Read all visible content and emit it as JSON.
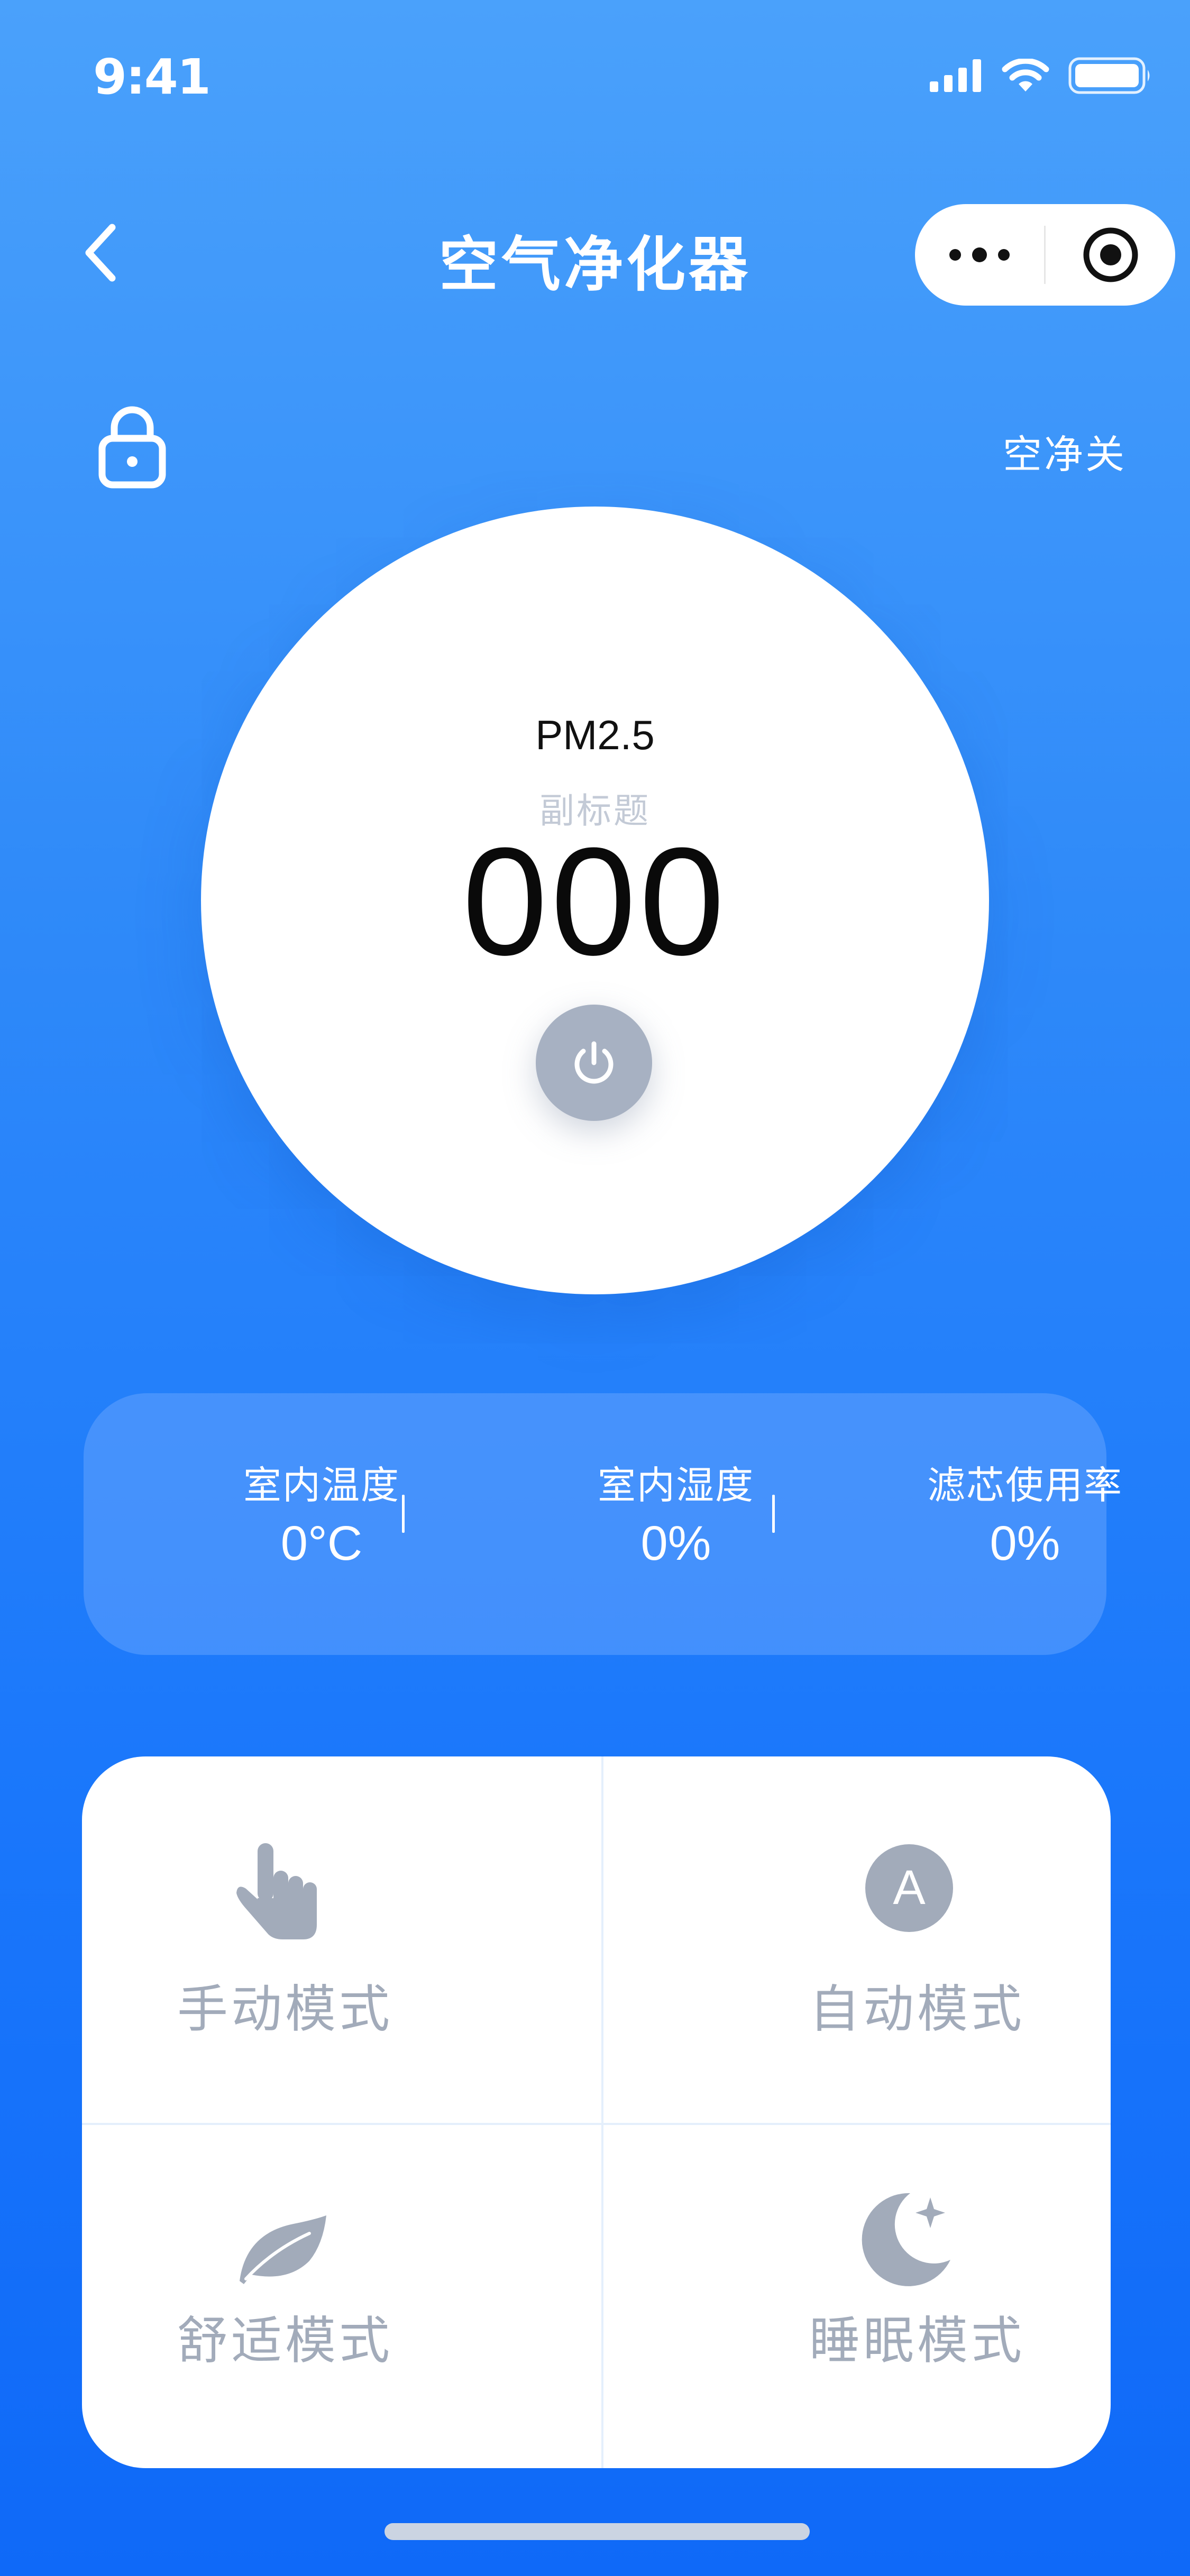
{
  "status_bar": {
    "time": "9:41"
  },
  "nav": {
    "title": "空气净化器"
  },
  "device": {
    "purifier_status": "空净关"
  },
  "dial": {
    "label": "PM2.5",
    "subtitle": "副标题",
    "value": "000"
  },
  "stats": [
    {
      "label": "室内温度",
      "value": "0°C"
    },
    {
      "label": "室内湿度",
      "value": "0%"
    },
    {
      "label": "滤芯使用率",
      "value": "0%"
    }
  ],
  "modes": [
    {
      "name": "手动模式",
      "icon": "hand-pointer-icon"
    },
    {
      "name": "自动模式",
      "icon": "auto-a-icon"
    },
    {
      "name": "舒适模式",
      "icon": "leaf-icon"
    },
    {
      "name": "睡眠模式",
      "icon": "moon-star-icon"
    }
  ],
  "colors": {
    "background_top": "#4aa1fb",
    "background_bottom": "#0f69f8",
    "mode_gray": "#a2abba",
    "power_gray": "#a7b1c2"
  }
}
